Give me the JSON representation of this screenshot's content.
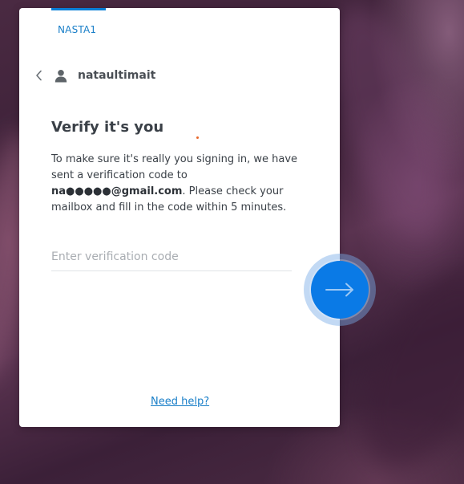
{
  "account": {
    "name": "NASTA1"
  },
  "user": {
    "username": "nataultimait",
    "back_icon": "chevron-left-icon",
    "avatar_icon": "user-icon"
  },
  "verify": {
    "title": "Verify it's you",
    "desc_before": "To make sure it's really you signing in, we have sent a verification code to ",
    "email": "na●●●●●@gmail.com",
    "desc_after": ". Please check your mailbox and fill in the code within 5 minutes."
  },
  "code_input": {
    "placeholder": "Enter verification code",
    "value": ""
  },
  "submit": {
    "icon": "arrow-right-icon"
  },
  "help": {
    "label": "Need help?"
  },
  "colors": {
    "accent": "#0a7ae6",
    "link": "#1a7fc8",
    "card": "#ffffff"
  }
}
